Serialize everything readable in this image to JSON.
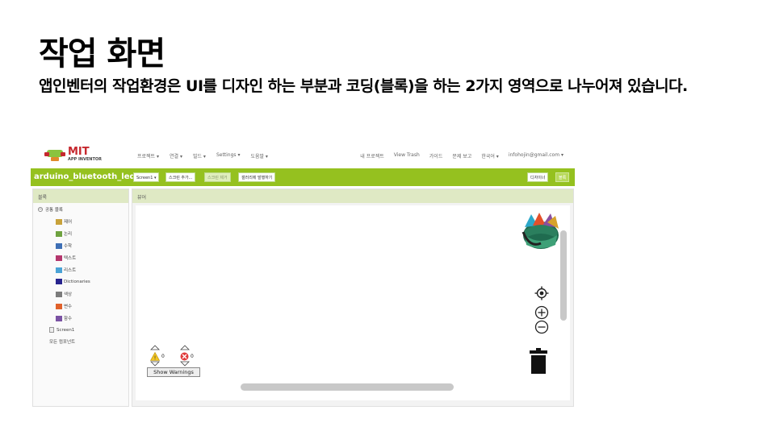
{
  "slide": {
    "title": "작업 화면",
    "body": "앱인벤터의 작업환경은 UI를 디자인 하는 부분과 코딩(블록)을 하는 2가지 영역으로 나누어져 있습니다."
  },
  "app": {
    "logo": {
      "main": "MIT",
      "sub": "APP INVENTOR"
    },
    "menu": [
      "프로젝트 ▾",
      "연결 ▾",
      "빌드 ▾",
      "Settings ▾",
      "도움말 ▾"
    ],
    "right_menu": [
      "내 프로젝트",
      "View Trash",
      "가이드",
      "문제 보고",
      "한국어 ▾",
      "infohojin@gmail.com ▾"
    ],
    "project_name": "arduino_bluetooth_led",
    "toolbar": {
      "screen_select": "Screen1 ▾",
      "add_screen": "스크린 추가...",
      "remove_screen": "스크린 제거",
      "publish_gallery": "갤러리에 발행하기",
      "designer": "디자이너",
      "blocks": "블록"
    },
    "blocks_panel": {
      "title": "블록",
      "builtin": "공통 블록",
      "categories": [
        {
          "label": "제어",
          "color": "#c8a23a"
        },
        {
          "label": "논리",
          "color": "#6ea23f"
        },
        {
          "label": "수학",
          "color": "#3e6fb5"
        },
        {
          "label": "텍스트",
          "color": "#b4366d"
        },
        {
          "label": "리스트",
          "color": "#4aa3d6"
        },
        {
          "label": "Dictionaries",
          "color": "#27238e"
        },
        {
          "label": "색상",
          "color": "#7c7c7c"
        },
        {
          "label": "변수",
          "color": "#e0612b"
        },
        {
          "label": "함수",
          "color": "#7a52a3"
        }
      ],
      "screen": "Screen1",
      "all_components": "모든 컴포넌트"
    },
    "viewer": {
      "title": "뷰어",
      "warnings_count": "0",
      "errors_count": "0",
      "show_warnings": "Show Warnings"
    }
  }
}
